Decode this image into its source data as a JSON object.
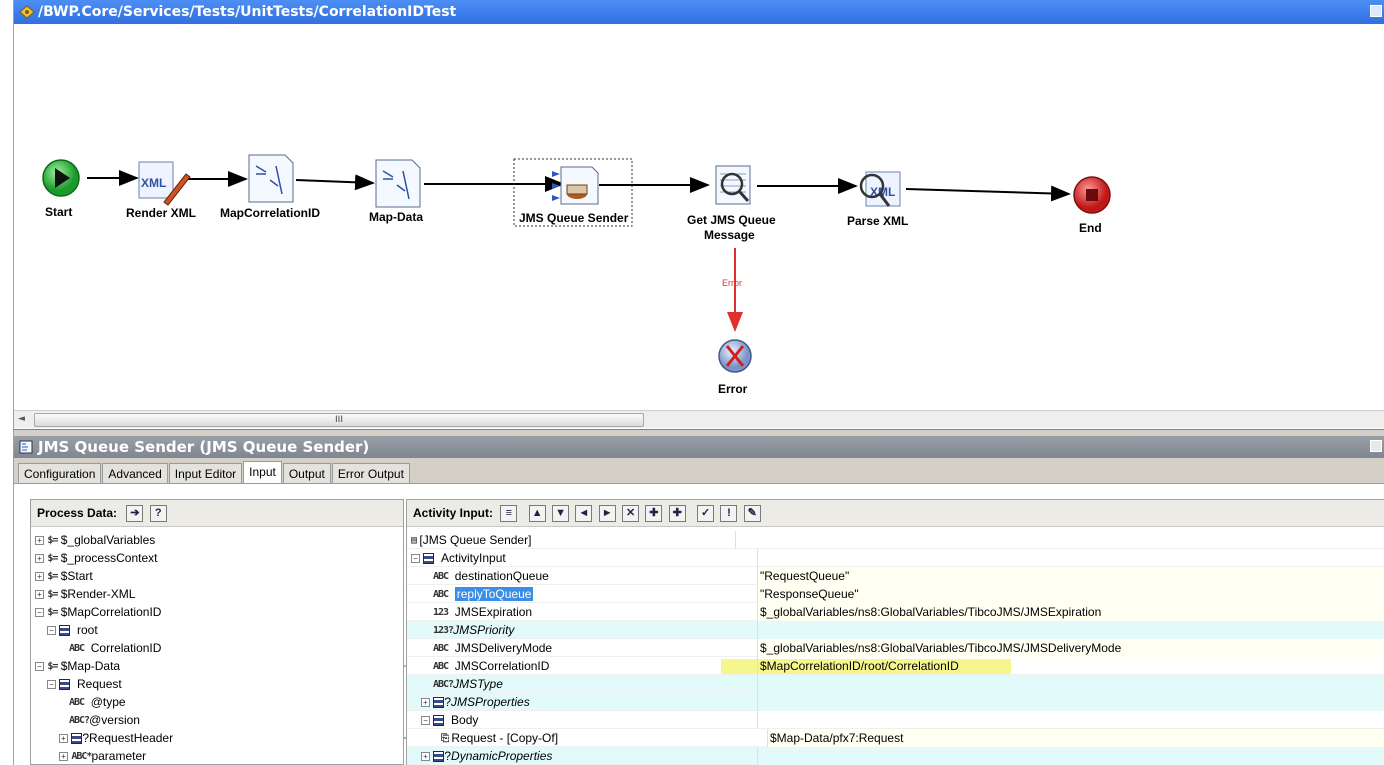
{
  "canvas": {
    "title": "/BWP.Core/Services/Tests/UnitTests/CorrelationIDTest",
    "nodes": {
      "start": "Start",
      "render_xml": "Render XML",
      "map_correlation_id": "MapCorrelationID",
      "map_data": "Map-Data",
      "jms_queue_sender": "JMS Queue Sender",
      "get_jms_queue_message_l1": "Get JMS Queue",
      "get_jms_queue_message_l2": "Message",
      "parse_xml": "Parse XML",
      "end": "End",
      "error": "Error"
    },
    "error_transition_label": "Error",
    "scroll_grip": "III"
  },
  "panel": {
    "title": "JMS Queue Sender (JMS Queue Sender)",
    "tabs": [
      "Configuration",
      "Advanced",
      "Input Editor",
      "Input",
      "Output",
      "Error Output"
    ],
    "active_tab": "Input"
  },
  "process_data": {
    "header": "Process Data:",
    "tree": [
      "$_globalVariables",
      "$_processContext",
      "$Start",
      "$Render-XML",
      "$MapCorrelationID",
      "root",
      "CorrelationID",
      "$Map-Data",
      "Request",
      "@type",
      "@version",
      "RequestHeader",
      "parameter"
    ]
  },
  "activity_input": {
    "header": "Activity Input:",
    "rows": [
      {
        "name": "[JMS Queue Sender]",
        "value": ""
      },
      {
        "name": "ActivityInput",
        "value": ""
      },
      {
        "name": "destinationQueue",
        "value": "\"RequestQueue\""
      },
      {
        "name": "replyToQueue",
        "value": "\"ResponseQueue\""
      },
      {
        "name": "JMSExpiration",
        "value": "$_globalVariables/ns8:GlobalVariables/TibcoJMS/JMSExpiration"
      },
      {
        "name": "JMSPriority",
        "value": ""
      },
      {
        "name": "JMSDeliveryMode",
        "value": "$_globalVariables/ns8:GlobalVariables/TibcoJMS/JMSDeliveryMode"
      },
      {
        "name": "JMSCorrelationID",
        "value": "$MapCorrelationID/root/CorrelationID"
      },
      {
        "name": "JMSType",
        "value": ""
      },
      {
        "name": "JMSProperties",
        "value": ""
      },
      {
        "name": "Body",
        "value": ""
      },
      {
        "name": "Request - [Copy-Of]",
        "value": "$Map-Data/pfx7:Request"
      },
      {
        "name": "DynamicProperties",
        "value": ""
      }
    ]
  }
}
